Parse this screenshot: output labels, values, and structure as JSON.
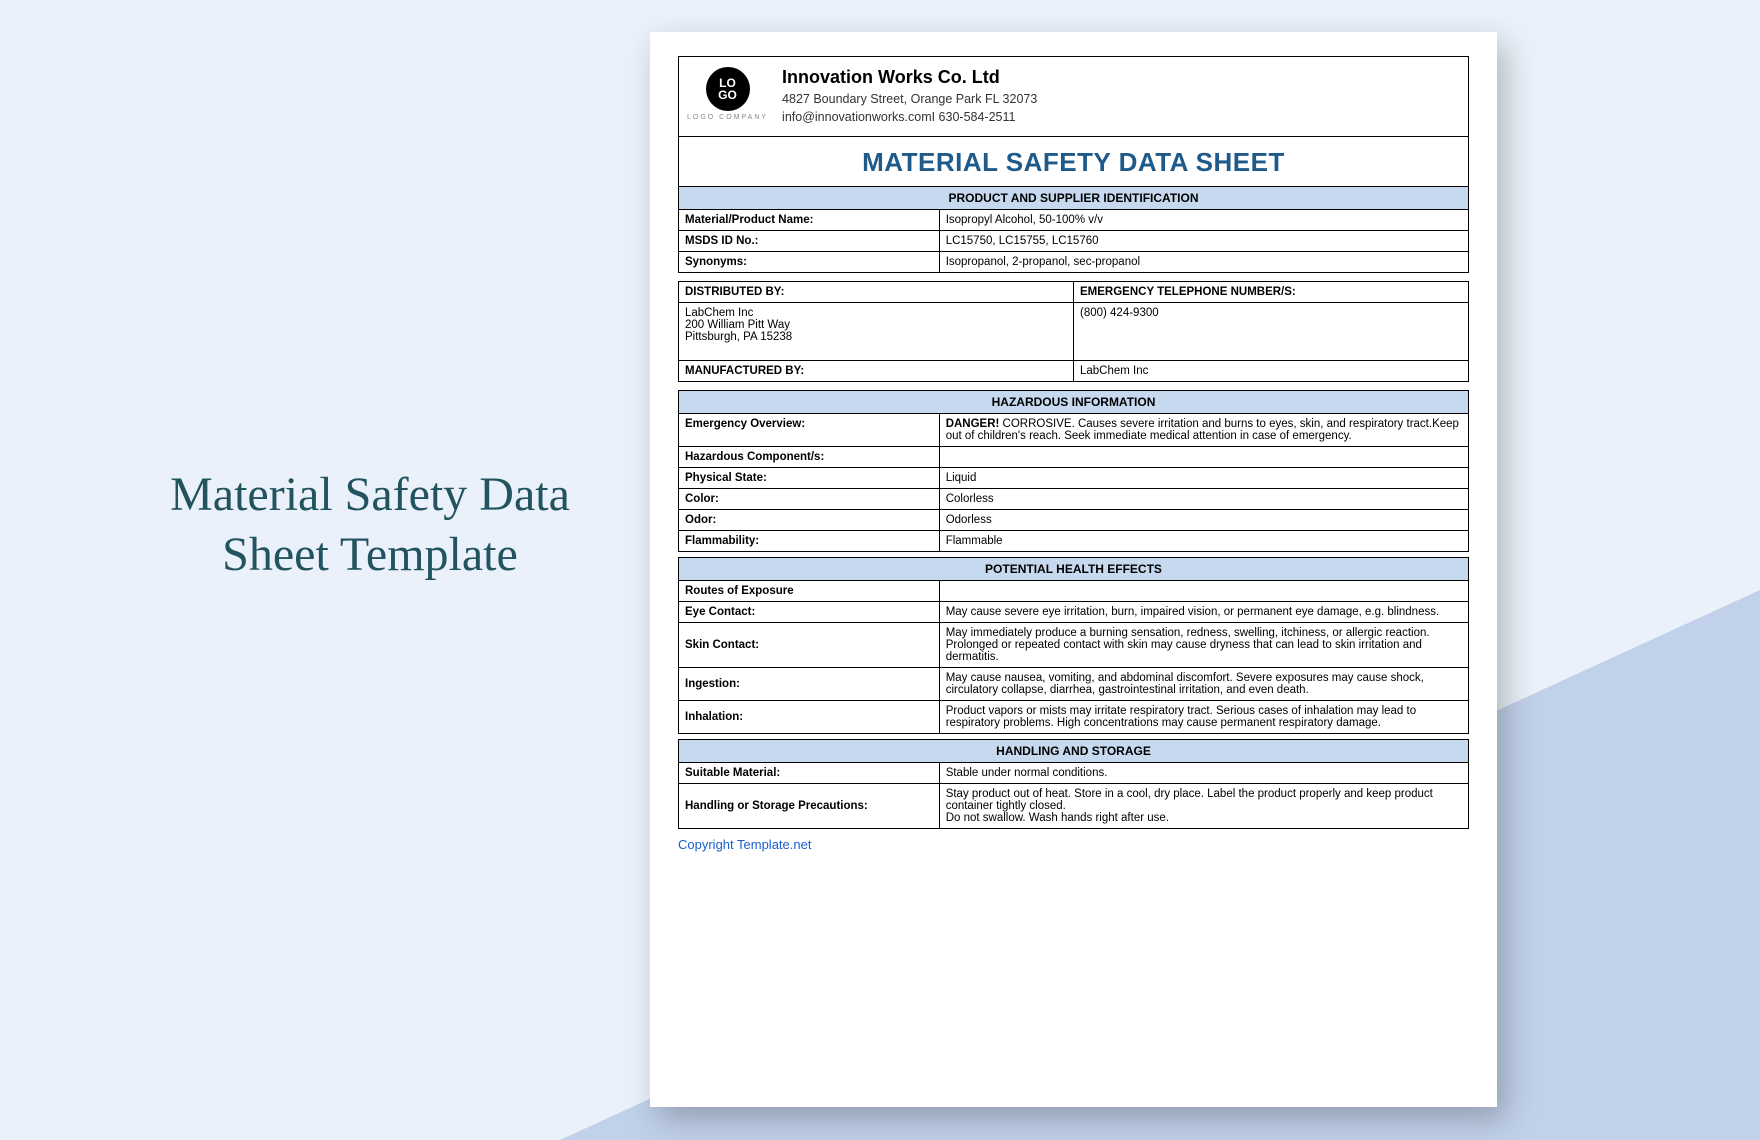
{
  "page_title": "Material Safety Data Sheet Template",
  "logo_text_top": "LO",
  "logo_text_bot": "GO",
  "logo_sub": "LOGO COMPANY",
  "company": {
    "name": "Innovation Works Co. Ltd",
    "address": "4827 Boundary Street, Orange Park FL 32073",
    "contact": "info@innovationworks.comI 630-584-2511"
  },
  "doc_title": "MATERIAL SAFETY DATA SHEET",
  "sections": {
    "product_id": "PRODUCT AND SUPPLIER IDENTIFICATION",
    "hazard": "HAZARDOUS INFORMATION",
    "health": "POTENTIAL HEALTH EFFECTS",
    "storage": "HANDLING AND STORAGE"
  },
  "product": {
    "material_label": "Material/Product Name:",
    "material_value": "Isopropyl Alcohol, 50-100% v/v",
    "msds_label": "MSDS ID No.:",
    "msds_value": "LC15750, LC15755, LC15760",
    "syn_label": "Synonyms:",
    "syn_value": "Isopropanol, 2-propanol, sec-propanol"
  },
  "supplier": {
    "dist_label": "DISTRIBUTED BY:",
    "emerg_label": "EMERGENCY TELEPHONE NUMBER/S:",
    "dist_value": "LabChem Inc\n200 William Pitt Way\nPittsburgh, PA 15238",
    "emerg_value": "(800) 424-9300",
    "mfg_label": "MANUFACTURED BY:",
    "mfg_value": "LabChem Inc"
  },
  "hazard": {
    "overview_label": "Emergency Overview:",
    "overview_prefix": "DANGER!",
    "overview_text": " CORROSIVE. Causes severe irritation and burns to eyes, skin, and respiratory tract.Keep out of children's reach. Seek immediate medical attention in case of emergency.",
    "components_label": "Hazardous Component/s:",
    "components_value": "",
    "state_label": "Physical State:",
    "state_value": "Liquid",
    "color_label": "Color:",
    "color_value": "Colorless",
    "odor_label": "Odor:",
    "odor_value": "Odorless",
    "flam_label": "Flammability:",
    "flam_value": "Flammable"
  },
  "health": {
    "routes_label": "Routes of Exposure",
    "routes_value": "",
    "eye_label": "Eye Contact:",
    "eye_value": "May cause severe eye irritation, burn, impaired vision, or permanent eye damage, e.g. blindness.",
    "skin_label": "Skin Contact:",
    "skin_value": "May immediately produce a burning sensation, redness, swelling, itchiness, or allergic reaction. Prolonged or repeated contact with skin may cause dryness that can lead to skin irritation and dermatitis.",
    "ing_label": "Ingestion:",
    "ing_value": "May cause nausea, vomiting, and abdominal discomfort. Severe exposures may cause shock, circulatory collapse, diarrhea, gastrointestinal irritation, and even death.",
    "inh_label": "Inhalation:",
    "inh_value": "Product vapors or mists may irritate respiratory tract. Serious cases of inhalation may lead to respiratory problems. High concentrations may cause permanent respiratory damage."
  },
  "storage": {
    "mat_label": "Suitable Material:",
    "mat_value": "Stable under normal conditions.",
    "prec_label": "Handling or Storage Precautions:",
    "prec_value": "Stay product out of heat. Store in a cool, dry place. Label the product properly and keep product container tightly closed.\nDo not swallow. Wash hands right after use."
  },
  "copyright": "Copyright Template.net"
}
